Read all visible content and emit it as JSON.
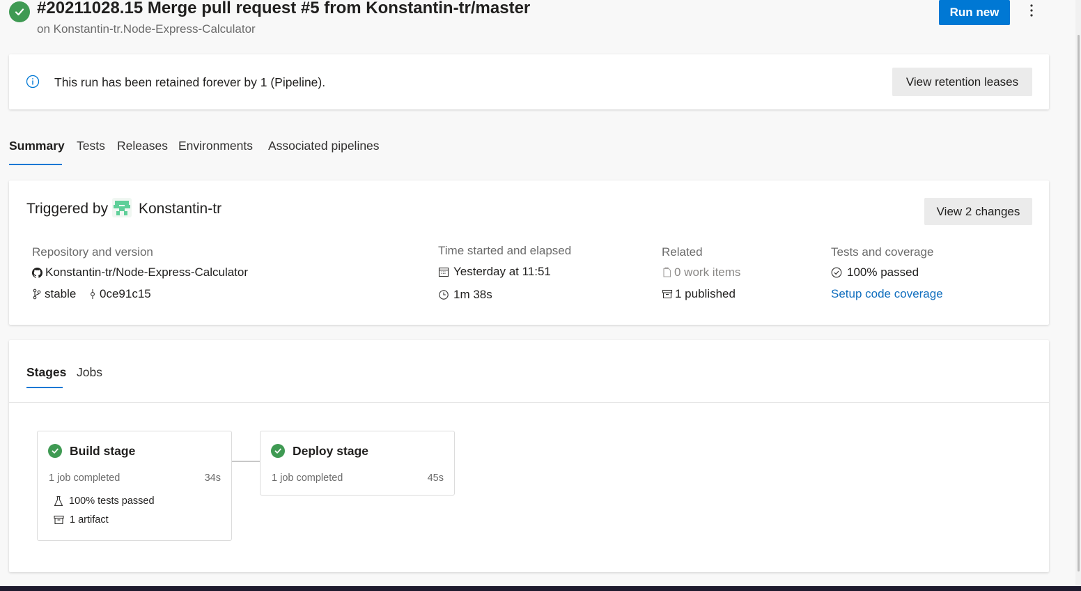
{
  "header": {
    "title": "#20211028.15 Merge pull request #5 from Konstantin-tr/master",
    "subtitle": "on Konstantin-tr.Node-Express-Calculator",
    "run_new_label": "Run new",
    "status": "succeeded"
  },
  "banner": {
    "text": "This run has been retained forever by 1 (Pipeline).",
    "button_label": "View retention leases"
  },
  "tabs": [
    {
      "label": "Summary",
      "selected": true
    },
    {
      "label": "Tests",
      "selected": false
    },
    {
      "label": "Releases",
      "selected": false
    },
    {
      "label": "Environments",
      "selected": false
    },
    {
      "label": "Associated pipelines",
      "selected": false
    }
  ],
  "summary": {
    "triggered_by_label": "Triggered by",
    "triggered_by_user": "Konstantin-tr",
    "view_changes_label": "View 2 changes",
    "repo": {
      "label": "Repository and version",
      "name": "Konstantin-tr/Node-Express-Calculator",
      "branch": "stable",
      "commit": "0ce91c15"
    },
    "time": {
      "label": "Time started and elapsed",
      "started": "Yesterday at 11:51",
      "elapsed": "1m 38s"
    },
    "related": {
      "label": "Related",
      "work_items": "0 work items",
      "published": "1 published"
    },
    "tests": {
      "label": "Tests and coverage",
      "passed": "100% passed",
      "coverage_link": "Setup code coverage"
    }
  },
  "stages_panel": {
    "tabs": [
      {
        "label": "Stages",
        "selected": true
      },
      {
        "label": "Jobs",
        "selected": false
      }
    ],
    "stages": [
      {
        "name": "Build stage",
        "jobs": "1 job completed",
        "duration": "34s",
        "tests": "100% tests passed",
        "artifacts": "1 artifact"
      },
      {
        "name": "Deploy stage",
        "jobs": "1 job completed",
        "duration": "45s"
      }
    ]
  },
  "colors": {
    "accent": "#0078d4",
    "success": "#3f9a53",
    "link": "#106ebe"
  }
}
